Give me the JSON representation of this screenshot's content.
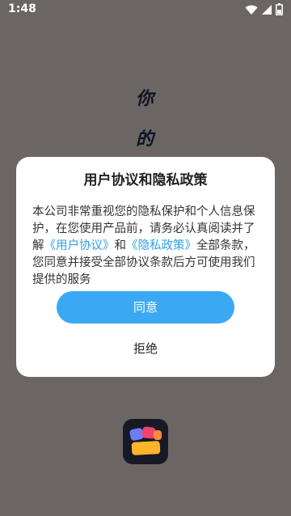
{
  "status_bar": {
    "time": "1:48",
    "icons": [
      "wifi-icon",
      "cell-signal-icon",
      "battery-icon"
    ]
  },
  "background": {
    "chars": [
      "你",
      "的"
    ],
    "logo_icon": "app-logo-icon"
  },
  "dialog": {
    "title": "用户协议和隐私政策",
    "body": {
      "text_1": "本公司非常重视您的隐私保护和个人信息保护，在您使用产品前，请务必认真阅读并了解",
      "link_user_agreement": "《用户协议》",
      "text_2": "和",
      "link_privacy_policy": "《隐私政策》",
      "text_3": "全部条款，您同意并接受全部协议条款后方可使用我们提供的服务"
    },
    "agree_label": "同意",
    "reject_label": "拒绝"
  },
  "colors": {
    "overlay": "#6b6664",
    "accent": "#3aa8f2",
    "link": "#2d9fe6"
  }
}
